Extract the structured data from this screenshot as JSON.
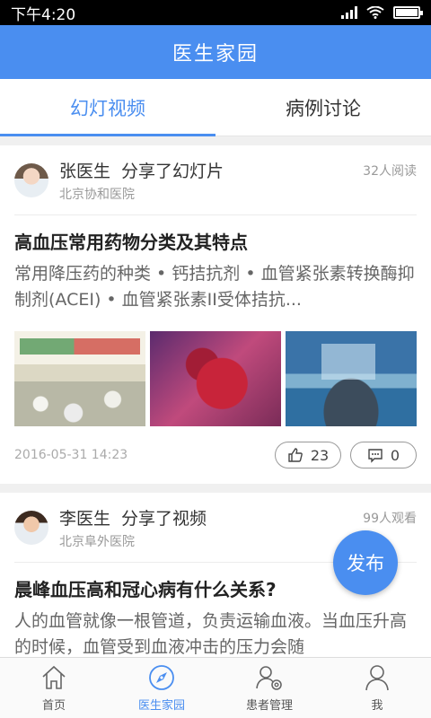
{
  "status": {
    "time": "下午4:20"
  },
  "header": {
    "title": "医生家园"
  },
  "tabs": [
    {
      "label": "幻灯视频",
      "active": true
    },
    {
      "label": "病例讨论",
      "active": false
    }
  ],
  "posts": [
    {
      "doctor": "张医生",
      "action": "分享了幻灯片",
      "hospital": "北京协和医院",
      "count": "32人阅读",
      "title": "高血压常用药物分类及其特点",
      "summary": "常用降压药的种类 • 钙拮抗剂 • 血管紧张素转换酶抑制剂(ACEI) • 血管紧张素II受体拮抗...",
      "date": "2016-05-31  14:23",
      "likes": "23",
      "comments": "0"
    },
    {
      "doctor": "李医生",
      "action": "分享了视频",
      "hospital": "北京阜外医院",
      "count": "99人观看",
      "title": "晨峰血压高和冠心病有什么关系?",
      "summary": "人的血管就像一根管道，负责运输血液。当血压升高的时候，血管受到血液冲击的压力会随"
    }
  ],
  "fab": {
    "label": "发布"
  },
  "nav": [
    {
      "label": "首页",
      "icon": "home-icon",
      "active": false
    },
    {
      "label": "医生家园",
      "icon": "compass-icon",
      "active": true
    },
    {
      "label": "患者管理",
      "icon": "patient-management-icon",
      "active": false
    },
    {
      "label": "我",
      "icon": "person-icon",
      "active": false
    }
  ],
  "colors": {
    "accent": "#4a8ef0"
  }
}
